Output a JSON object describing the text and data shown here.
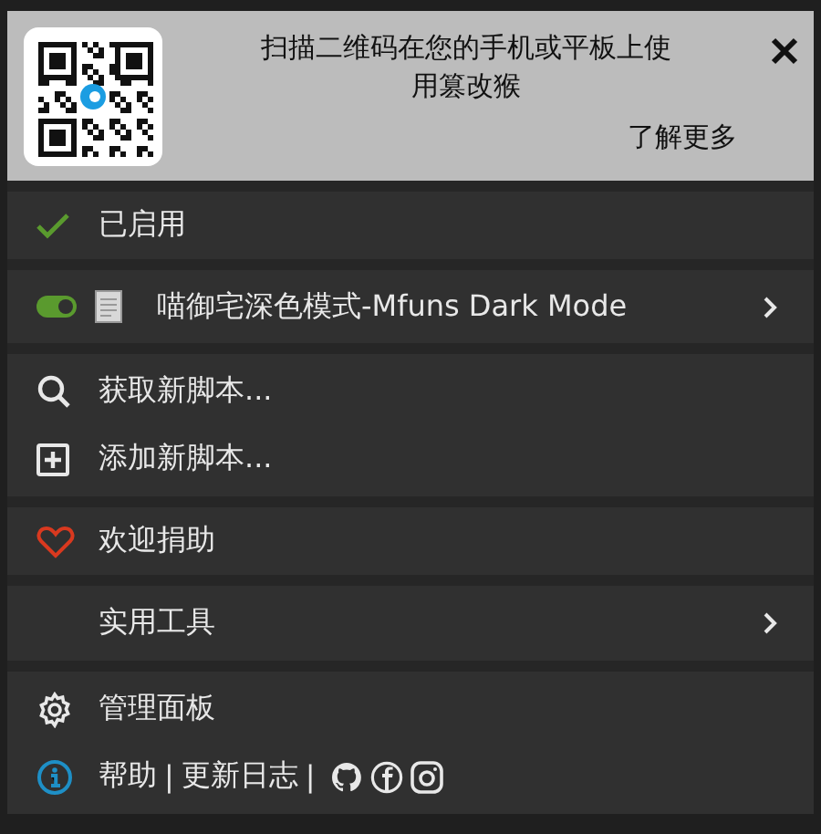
{
  "banner": {
    "message": "扫描二维码在您的手机或平板上使用篡改猴",
    "learn_more": "了解更多"
  },
  "sections": [
    [
      {
        "kind": "status",
        "label": "已启用",
        "checked": true
      }
    ],
    [
      {
        "kind": "script",
        "label": "喵御宅深色模式-Mfuns Dark Mode",
        "enabled": true,
        "submenu": true
      }
    ],
    [
      {
        "kind": "search",
        "label": "获取新脚本..."
      },
      {
        "kind": "add",
        "label": "添加新脚本..."
      }
    ],
    [
      {
        "kind": "donate",
        "label": "欢迎捐助"
      }
    ],
    [
      {
        "kind": "tools",
        "label": "实用工具",
        "submenu": true
      }
    ],
    [
      {
        "kind": "settings",
        "label": "管理面板"
      },
      {
        "kind": "help",
        "links": [
          "帮助",
          "更新日志"
        ],
        "separator": "|"
      }
    ]
  ]
}
